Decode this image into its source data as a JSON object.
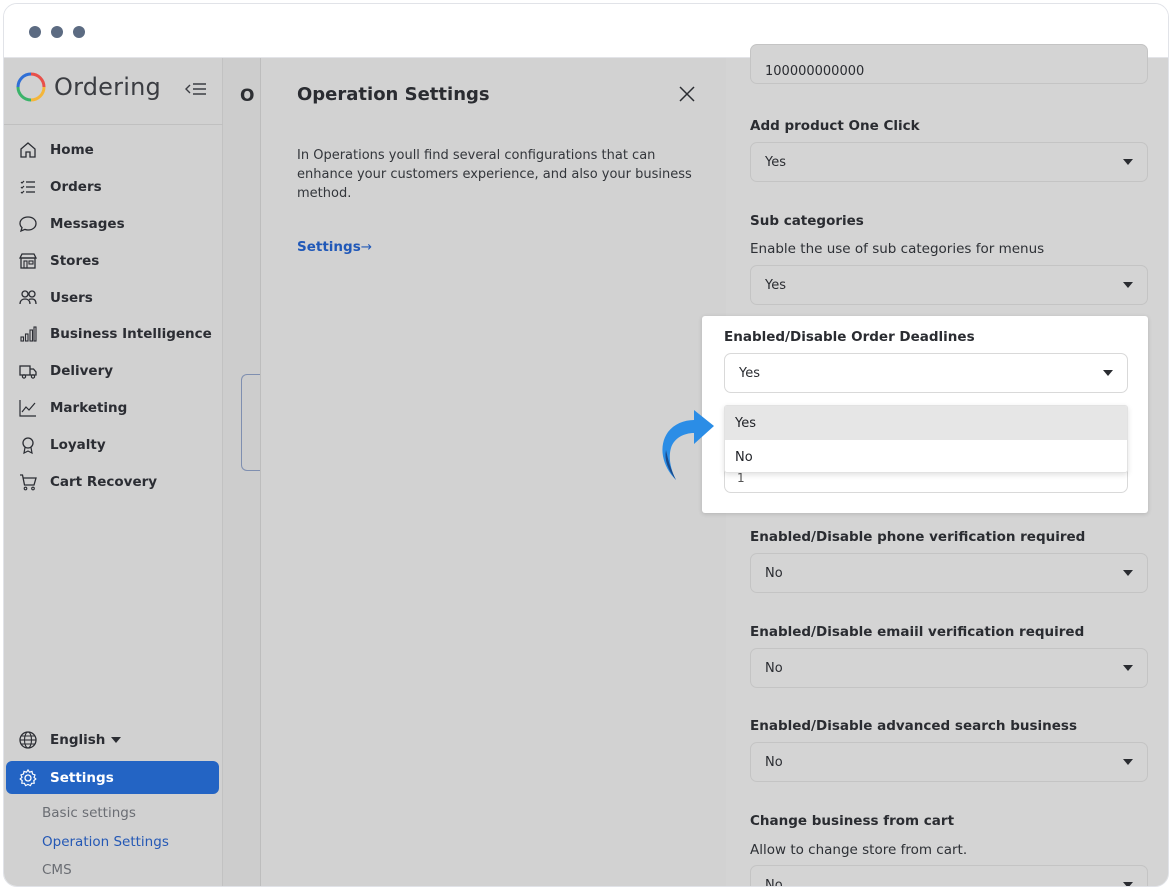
{
  "sidebar": {
    "brand": "Ordering",
    "items": [
      {
        "label": "Home",
        "icon": "home-icon"
      },
      {
        "label": "Orders",
        "icon": "list-icon"
      },
      {
        "label": "Messages",
        "icon": "chat-bubble-icon"
      },
      {
        "label": "Stores",
        "icon": "store-icon"
      },
      {
        "label": "Users",
        "icon": "users-icon"
      },
      {
        "label": "Business Intelligence",
        "icon": "bar-chart-icon"
      },
      {
        "label": "Delivery",
        "icon": "truck-icon"
      },
      {
        "label": "Marketing",
        "icon": "trend-line-icon"
      },
      {
        "label": "Loyalty",
        "icon": "award-icon"
      },
      {
        "label": "Cart Recovery",
        "icon": "cart-icon"
      }
    ],
    "language": "English",
    "settings_label": "Settings",
    "sub_items": [
      "Basic settings",
      "Operation Settings",
      "CMS"
    ]
  },
  "main": {
    "title_fragment": "O"
  },
  "drawer": {
    "title": "Operation Settings",
    "description": "In Operations youll find several configurations that can enhance your customers experience, and also your business method.",
    "link": "Settings",
    "link_arrow": "→"
  },
  "column": {
    "top_value": "100000000000",
    "add_product_label": "Add product One Click",
    "add_product_value": "Yes",
    "sub_categories_label": "Sub categories",
    "sub_categories_help": "Enable the use of sub categories for menus",
    "sub_categories_value": "Yes",
    "phone_label": "Enabled/Disable phone verification required",
    "phone_value": "No",
    "email_label": "Enabled/Disable emaiil verification required",
    "email_value": "No",
    "search_label": "Enabled/Disable advanced search business",
    "search_value": "No",
    "change_label": "Change business from cart",
    "change_help": "Allow to change store from cart.",
    "change_value": "No"
  },
  "popup": {
    "label": "Enabled/Disable Order Deadlines",
    "selected": "Yes",
    "options": [
      "Yes",
      "No"
    ],
    "under_value": "1"
  },
  "colors": {
    "accent": "#2364c4",
    "pointer": "#2b8de6",
    "pointer_dark": "#1a4a8a"
  }
}
